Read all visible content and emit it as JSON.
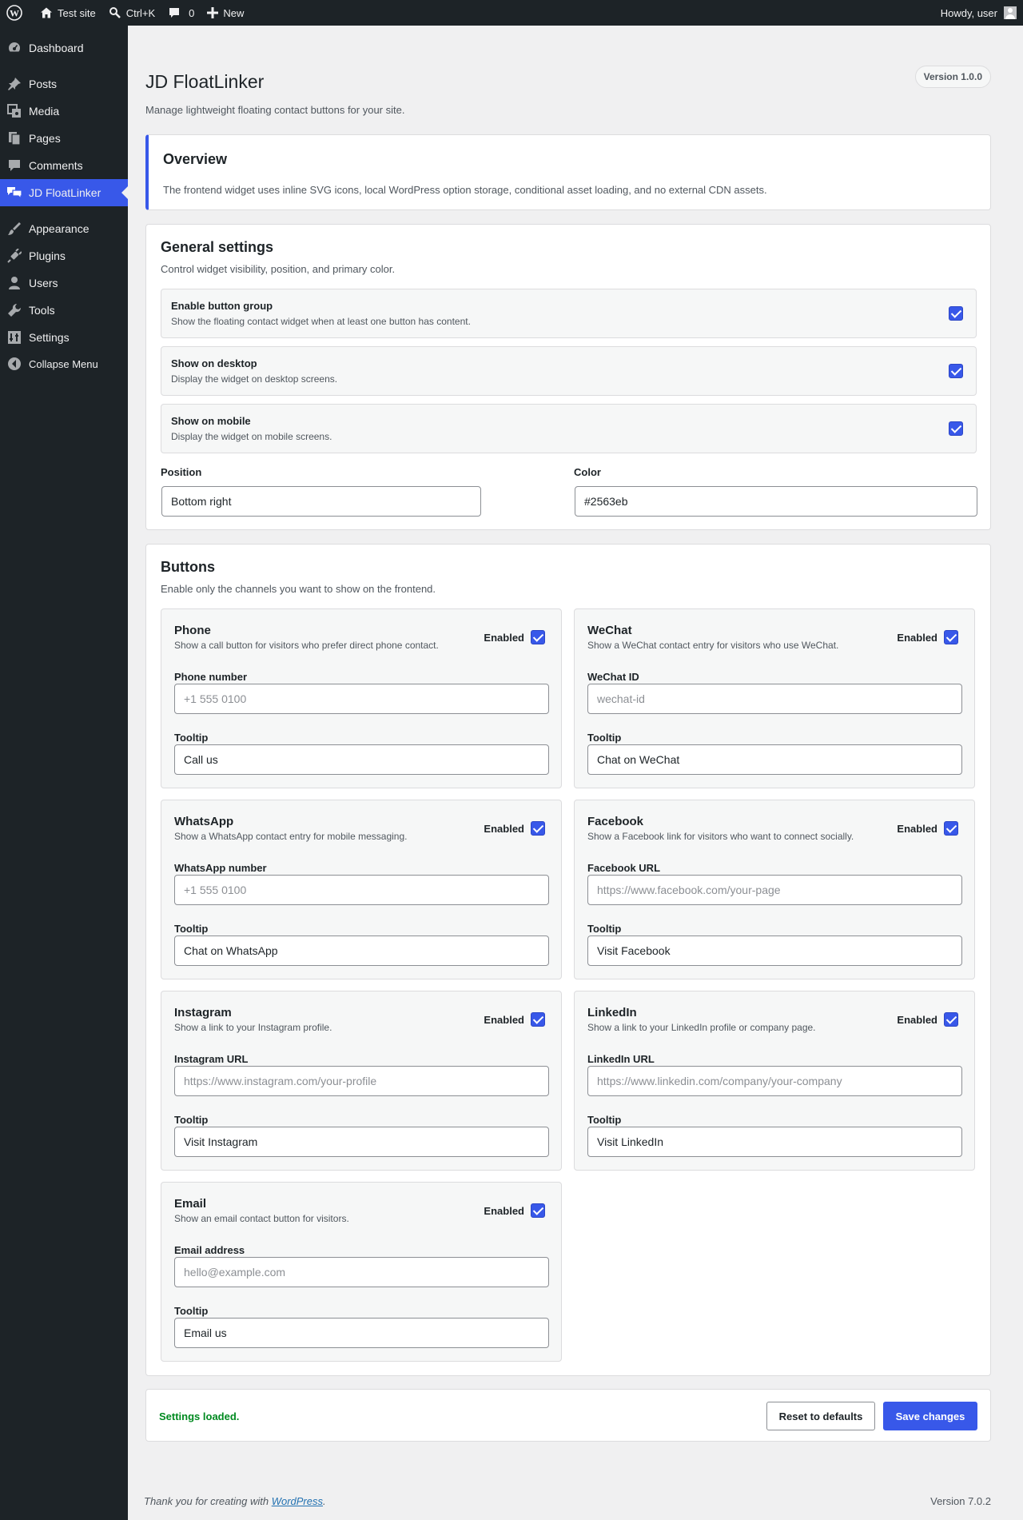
{
  "adminbar": {
    "site_name": "Test site",
    "search_shortcut": "Ctrl+K",
    "comments_count": "0",
    "new_label": "New",
    "howdy": "Howdy, user"
  },
  "sidebar": {
    "items": [
      {
        "label": "Dashboard",
        "icon": "dashboard-icon"
      },
      {
        "label": "Posts",
        "icon": "pin-icon"
      },
      {
        "label": "Media",
        "icon": "media-icon"
      },
      {
        "label": "Pages",
        "icon": "pages-icon"
      },
      {
        "label": "Comments",
        "icon": "comment-icon"
      },
      {
        "label": "JD FloatLinker",
        "icon": "chat-bubbles-icon",
        "current": true
      },
      {
        "label": "Appearance",
        "icon": "brush-icon"
      },
      {
        "label": "Plugins",
        "icon": "plug-icon"
      },
      {
        "label": "Users",
        "icon": "user-icon"
      },
      {
        "label": "Tools",
        "icon": "wrench-icon"
      },
      {
        "label": "Settings",
        "icon": "sliders-icon"
      }
    ],
    "collapse_label": "Collapse Menu",
    "accent": "#3858e9"
  },
  "page": {
    "title": "JD FloatLinker",
    "description": "Manage lightweight floating contact buttons for your site.",
    "version_badge": "Version 1.0.0"
  },
  "overview": {
    "title": "Overview",
    "text": "The frontend widget uses inline SVG icons, local WordPress option storage, conditional asset loading, and no external CDN assets."
  },
  "general": {
    "title": "General settings",
    "description": "Control widget visibility, position, and primary color.",
    "toggles": [
      {
        "label": "Enable button group",
        "desc": "Show the floating contact widget when at least one button has content.",
        "checked": true
      },
      {
        "label": "Show on desktop",
        "desc": "Display the widget on desktop screens.",
        "checked": true
      },
      {
        "label": "Show on mobile",
        "desc": "Display the widget on mobile screens.",
        "checked": true
      }
    ],
    "position_label": "Position",
    "position_value": "Bottom right",
    "color_label": "Color",
    "color_value": "#2563eb"
  },
  "buttons": {
    "title": "Buttons",
    "description": "Enable only the channels you want to show on the frontend.",
    "enabled_label": "Enabled",
    "tooltip_label": "Tooltip",
    "items": [
      {
        "name": "Phone",
        "desc": "Show a call button for visitors who prefer direct phone contact.",
        "field_label": "Phone number",
        "field_placeholder": "+1 555 0100",
        "tooltip": "Call us",
        "enabled": true
      },
      {
        "name": "WeChat",
        "desc": "Show a WeChat contact entry for visitors who use WeChat.",
        "field_label": "WeChat ID",
        "field_placeholder": "wechat-id",
        "tooltip": "Chat on WeChat",
        "enabled": true
      },
      {
        "name": "WhatsApp",
        "desc": "Show a WhatsApp contact entry for mobile messaging.",
        "field_label": "WhatsApp number",
        "field_placeholder": "+1 555 0100",
        "tooltip": "Chat on WhatsApp",
        "enabled": true
      },
      {
        "name": "Facebook",
        "desc": "Show a Facebook link for visitors who want to connect socially.",
        "field_label": "Facebook URL",
        "field_placeholder": "https://www.facebook.com/your-page",
        "tooltip": "Visit Facebook",
        "enabled": true
      },
      {
        "name": "Instagram",
        "desc": "Show a link to your Instagram profile.",
        "field_label": "Instagram URL",
        "field_placeholder": "https://www.instagram.com/your-profile",
        "tooltip": "Visit Instagram",
        "enabled": true
      },
      {
        "name": "LinkedIn",
        "desc": "Show a link to your LinkedIn profile or company page.",
        "field_label": "LinkedIn URL",
        "field_placeholder": "https://www.linkedin.com/company/your-company",
        "tooltip": "Visit LinkedIn",
        "enabled": true
      },
      {
        "name": "Email",
        "desc": "Show an email contact button for visitors.",
        "field_label": "Email address",
        "field_placeholder": "hello@example.com",
        "tooltip": "Email us",
        "enabled": true
      }
    ]
  },
  "actions": {
    "status": "Settings loaded.",
    "reset_label": "Reset to defaults",
    "save_label": "Save changes"
  },
  "footer": {
    "thanks_prefix": "Thank you for creating with ",
    "thanks_link": "WordPress",
    "thanks_suffix": ".",
    "version": "Version 7.0.2"
  }
}
